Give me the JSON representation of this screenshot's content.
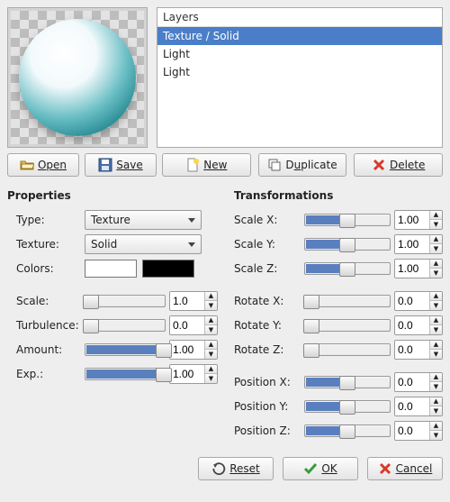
{
  "layers": {
    "header": "Layers",
    "items": [
      "Texture / Solid",
      "Light",
      "Light"
    ],
    "selected_index": 0
  },
  "buttons": {
    "open": "Open",
    "save": "Save",
    "new": "New",
    "duplicate": "Duplicate",
    "delete": "Delete",
    "reset": "Reset",
    "ok": "OK",
    "cancel": "Cancel"
  },
  "properties": {
    "heading": "Properties",
    "type_label": "Type:",
    "type_value": "Texture",
    "texture_label": "Texture:",
    "texture_value": "Solid",
    "colors_label": "Colors:",
    "color1": "#ffffff",
    "color2": "#000000",
    "scale_label": "Scale:",
    "scale_value": "1.0",
    "scale_fill": 6,
    "turbulence_label": "Turbulence:",
    "turbulence_value": "0.0",
    "turbulence_fill": 6,
    "amount_label": "Amount:",
    "amount_value": "1.00",
    "amount_fill": 100,
    "exp_label": "Exp.:",
    "exp_value": "1.00",
    "exp_fill": 100
  },
  "transformations": {
    "heading": "Transformations",
    "scale_x": {
      "label": "Scale X:",
      "value": "1.00",
      "fill": 50
    },
    "scale_y": {
      "label": "Scale Y:",
      "value": "1.00",
      "fill": 50
    },
    "scale_z": {
      "label": "Scale Z:",
      "value": "1.00",
      "fill": 50
    },
    "rotate_x": {
      "label": "Rotate X:",
      "value": "0.0",
      "fill": 6
    },
    "rotate_y": {
      "label": "Rotate Y:",
      "value": "0.0",
      "fill": 6
    },
    "rotate_z": {
      "label": "Rotate Z:",
      "value": "0.0",
      "fill": 6
    },
    "position_x": {
      "label": "Position X:",
      "value": "0.0",
      "fill": 50
    },
    "position_y": {
      "label": "Position Y:",
      "value": "0.0",
      "fill": 50
    },
    "position_z": {
      "label": "Position Z:",
      "value": "0.0",
      "fill": 50
    }
  }
}
